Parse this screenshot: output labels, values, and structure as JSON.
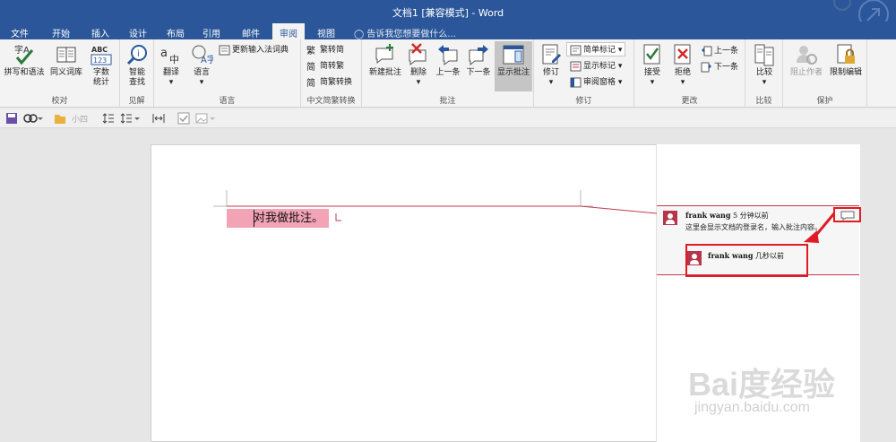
{
  "window": {
    "title": "文档1 [兼容模式] - Word"
  },
  "tabs": [
    "文件",
    "开始",
    "插入",
    "设计",
    "布局",
    "引用",
    "邮件",
    "审阅",
    "视图"
  ],
  "active_tab": "审阅",
  "tell_me": "告诉我您想要做什么...",
  "ribbon": {
    "proofing": {
      "label": "校对",
      "spelling": "拼写和语法",
      "thesaurus": "同义词库",
      "wordcount": "字数统计",
      "wordcount_l1": "字数",
      "wordcount_l2": "统计",
      "wordcount_icon": "ABC\n123"
    },
    "insights": {
      "label": "见解",
      "smart_l1": "智能",
      "smart_l2": "查找"
    },
    "language": {
      "label": "语言",
      "translate": "翻译",
      "language": "语言",
      "update_ime": "更新输入法词典"
    },
    "chinese": {
      "label": "中文简繁转换",
      "to_simplified": "繁转简",
      "to_traditional": "简转繁",
      "convert": "简繁转换"
    },
    "comments": {
      "label": "批注",
      "new": "新建批注",
      "delete": "删除",
      "prev": "上一条",
      "next": "下一条",
      "show": "显示批注"
    },
    "tracking": {
      "label": "修订",
      "track": "修订",
      "markup": "简单标记",
      "show_markup": "显示标记",
      "pane": "审阅窗格"
    },
    "changes": {
      "label": "更改",
      "accept": "接受",
      "reject": "拒绝",
      "prev": "上一条",
      "next": "下一条"
    },
    "compare": {
      "label": "比较",
      "compare": "比较"
    },
    "protect": {
      "label": "保护",
      "block": "阻止作者",
      "restrict": "限制编辑"
    }
  },
  "qat": {
    "font_size": "小四"
  },
  "document": {
    "text": "对我做批注。"
  },
  "comments": [
    {
      "author": "frank wang",
      "time": "5 分钟以前",
      "text": "这里会显示文档的登录名，输入批注内容。"
    },
    {
      "author": "frank wang",
      "time": "几秒以前",
      "text": ""
    }
  ],
  "watermark": {
    "brand": "Bai度经验",
    "url": "jingyan.baidu.com"
  },
  "colors": {
    "accent": "#2b579a",
    "comment": "#b5364b",
    "highlight": "#e01b24"
  }
}
